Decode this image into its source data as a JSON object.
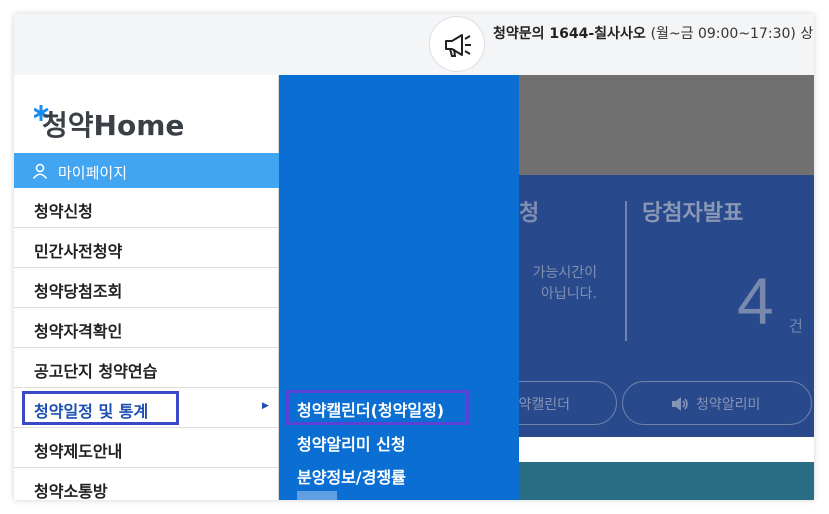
{
  "header": {
    "notice_label": "청약문의",
    "phone": "1644-칠사사오",
    "hours": "(월~금 09:00~17:30) 상",
    "megaphone_icon": "megaphone-icon"
  },
  "logo": {
    "text": "청약Home",
    "star_color": "#1a8cf0"
  },
  "sidebar": {
    "mypage": {
      "label": "마이페이지",
      "icon": "person-icon"
    },
    "items": [
      {
        "label": "청약신청"
      },
      {
        "label": "민간사전청약"
      },
      {
        "label": "청약당첨조회"
      },
      {
        "label": "청약자격확인"
      },
      {
        "label": "공고단지 청약연습"
      },
      {
        "label": "청약일정 및 통계",
        "active": true,
        "arrow": "▶"
      },
      {
        "label": "청약제도안내"
      },
      {
        "label": "청약소통방"
      }
    ]
  },
  "submenu": {
    "items": [
      {
        "label": "청약캘린더(청약일정)"
      },
      {
        "label": "청약알리미 신청"
      },
      {
        "label": "분양정보/경쟁률"
      }
    ]
  },
  "background": {
    "apply_fragment": "청",
    "winners_title": "당첨자발표",
    "notice_fragment": "가능시간이\n아닙니다.",
    "winners_count": "4",
    "count_unit": "건",
    "calendar_button": "약캘린더",
    "alarm_button": "청약알리미",
    "speaker_icon": "speaker-icon"
  },
  "colors": {
    "submenu_bg": "#0a6ed3",
    "mypage_bg": "#41a5f2",
    "highlight_box": "#3a49c9",
    "panel_blue": "#284a8d"
  }
}
